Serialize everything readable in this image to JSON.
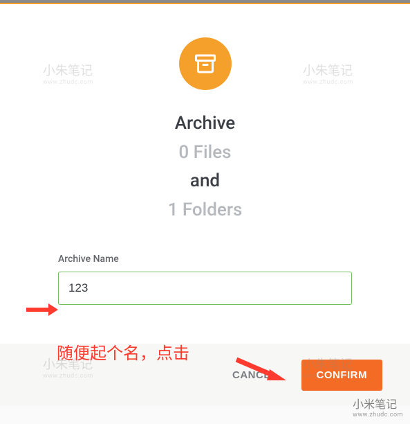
{
  "dialog": {
    "heading": {
      "line1": "Archive",
      "line2": "0 Files",
      "line3": "and",
      "line4": "1 Folders"
    },
    "form": {
      "archive_name_label": "Archive Name",
      "archive_name_value": "123"
    },
    "buttons": {
      "cancel": "CANCEL",
      "confirm": "CONFIRM"
    }
  },
  "annotation": {
    "text": "随便起个名，点击"
  },
  "watermark": {
    "brand": "小朱笔记",
    "url": "www.zhudc.com",
    "footer_brand": "小米笔记"
  }
}
